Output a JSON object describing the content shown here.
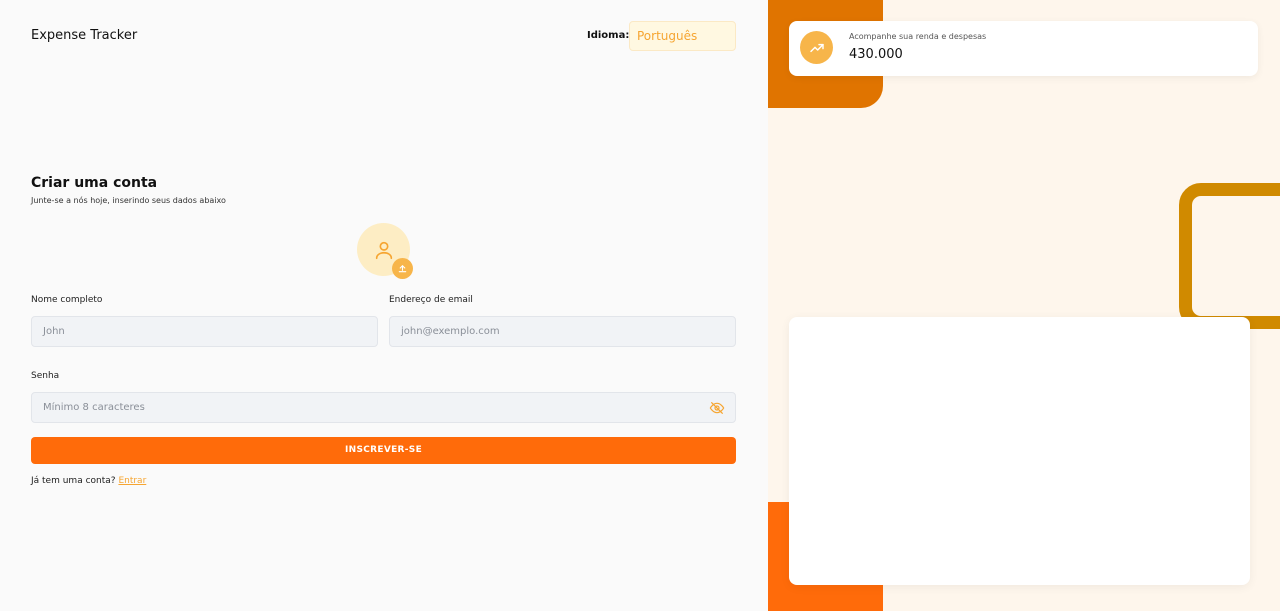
{
  "header": {
    "app_title": "Expense Tracker",
    "language_label": "Idioma:",
    "language_value": "Português"
  },
  "form": {
    "heading": "Criar uma conta",
    "subheading": "Junte-se a nós hoje, inserindo seus dados abaixo",
    "full_name_label": "Nome completo",
    "full_name_placeholder": "John",
    "email_label": "Endereço de email",
    "email_placeholder": "john@exemplo.com",
    "password_label": "Senha",
    "password_placeholder": "Mínimo 8 caracteres",
    "submit_label": "INSCREVER-SE",
    "login_prompt": "Já tem uma conta?",
    "login_link": "Entrar"
  },
  "side_panel": {
    "stat_label": "Acompanhe sua renda e despesas",
    "stat_value": "430.000"
  },
  "icons": {
    "avatar": "user-icon",
    "upload": "upload-icon",
    "password_toggle": "eye-off-icon",
    "stat": "trending-up-icon"
  },
  "colors": {
    "primary": "#ff6b0a",
    "accent": "#f6a531",
    "dark_orange": "#e07400",
    "gold": "#d08a00",
    "right_bg": "#fef6ec"
  }
}
